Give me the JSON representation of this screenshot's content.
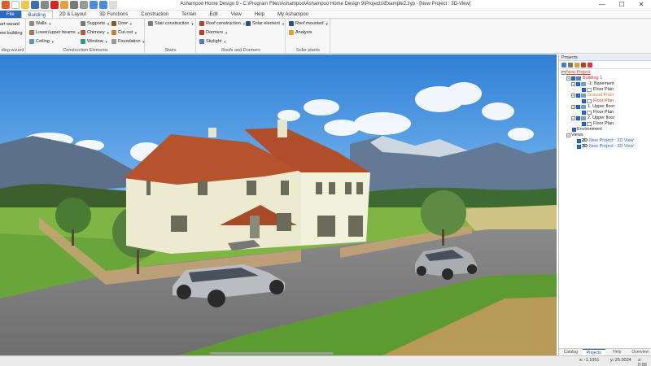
{
  "window": {
    "title": "Ashampoo Home Design 9 - C:\\Program Files\\Ashampoo\\Ashampoo Home Design 9\\Projects\\Example2.zyp - [New Project : 3D-View]",
    "controls": [
      "—",
      "☐",
      "✕"
    ]
  },
  "menu": {
    "tabs": [
      "File",
      "Building",
      "2D & Layout",
      "3D Functions",
      "Construction",
      "Terrain",
      "Edit",
      "View",
      "Help",
      "My Ashampoo"
    ]
  },
  "ribbon": {
    "wizard": {
      "start_wizard": "art wizard",
      "new_building": "ew building",
      "label": "ding wizard"
    },
    "construction": {
      "walls": "Walls",
      "lower_upper_beams": "Lower/upper beams",
      "ceiling": "Ceiling",
      "supports": "Supports",
      "chimney": "Chimney",
      "window": "Window",
      "door": "Door",
      "cut_out": "Cut-out",
      "foundation": "Foundation",
      "label": "Construction Elements"
    },
    "stairs": {
      "stair_construction": "Stair construction",
      "label": "Stairs"
    },
    "roofs": {
      "roof_construction": "Roof construction",
      "dormers": "Dormers",
      "skylight": "Skylight",
      "solar_element": "Solar element",
      "label": "Roofs and Dormers"
    },
    "solar": {
      "roof_mounted": "Roof mounted",
      "analysis": "Analysis",
      "label": "Solar plants"
    }
  },
  "panel": {
    "title": "Projects",
    "tree": {
      "project": "New Project",
      "building": "Building 1",
      "basement_level": "-1: Basement",
      "basement_plan": "Floor Plan",
      "ground_level": "Ground Floor",
      "ground_plan": "Floor Plan",
      "upper1_level": "1. Upper floor",
      "upper1_plan": "Floor Plan",
      "upper2_level": "2. Upper floor",
      "upper2_plan": "Floor Plan",
      "environment": "Environment",
      "views": "Views",
      "view_2d_tag": "2D",
      "view_2d": "New Project : 2D View",
      "view_3d_tag": "3D",
      "view_3d": "New Project : 3D View"
    },
    "tabs": [
      "Catalog",
      "Projects",
      "Help",
      "Overview"
    ]
  },
  "status": {
    "x": "x: -1.1051",
    "y": "y: 25.0024",
    "z": "z: 0.00"
  },
  "colors": {
    "accent": "#2b6bc0",
    "active_item": "#d9322c",
    "selected_item": "#e07b20",
    "view_item": "#2467c6",
    "sky_top": "#3f8fe0",
    "grass": "#6fae3a",
    "roof": "#b5532f",
    "wall": "#ecebcf"
  }
}
